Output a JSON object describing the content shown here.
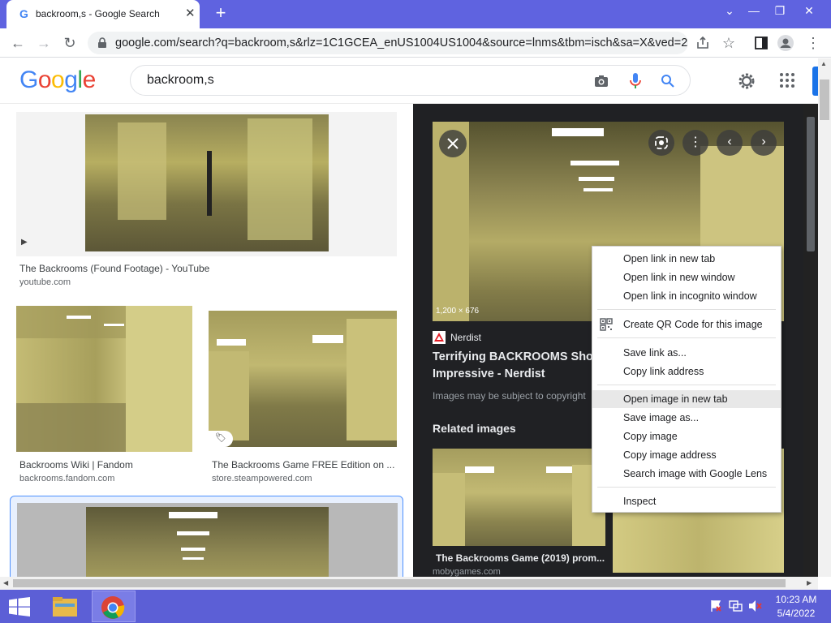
{
  "browser": {
    "tab_title": "backroom,s - Google Search",
    "url": "google.com/search?q=backroom,s&rlz=1C1GCEA_enUS1004US1004&source=lnms&tbm=isch&sa=X&ved=2ah..."
  },
  "google": {
    "logo_letters": [
      "G",
      "o",
      "o",
      "g",
      "l",
      "e"
    ],
    "logo_colors": [
      "#4285f4",
      "#ea4335",
      "#fbbc05",
      "#4285f4",
      "#34a853",
      "#ea4335"
    ],
    "query": "backroom,s"
  },
  "results": [
    {
      "caption": "The Backrooms (Found Footage) - YouTube",
      "site": "youtube.com"
    },
    {
      "caption": "Backrooms Wiki | Fandom",
      "site": "backrooms.fandom.com"
    },
    {
      "caption": "The Backrooms Game FREE Edition on ...",
      "site": "store.steampowered.com"
    }
  ],
  "panel": {
    "dimensions": "1,200 × 676",
    "source": "Nerdist",
    "title_line1": "Terrifying BACKROOMS Shor",
    "title_line2": "Impressive - Nerdist",
    "copyright": "Images may be subject to copyright",
    "related_heading": "Related images",
    "related": [
      {
        "caption": "The Backrooms Game (2019) prom...",
        "site": "mobygames.com"
      }
    ]
  },
  "context_menu": {
    "items": [
      "Open link in new tab",
      "Open link in new window",
      "Open link in incognito window",
      "Create QR Code for this image",
      "Save link as...",
      "Copy link address",
      "Open image in new tab",
      "Save image as...",
      "Copy image",
      "Copy image address",
      "Search image with Google Lens",
      "Inspect"
    ],
    "highlighted": "Open image in new tab"
  },
  "taskbar": {
    "time": "10:23 AM",
    "date": "5/4/2022"
  }
}
